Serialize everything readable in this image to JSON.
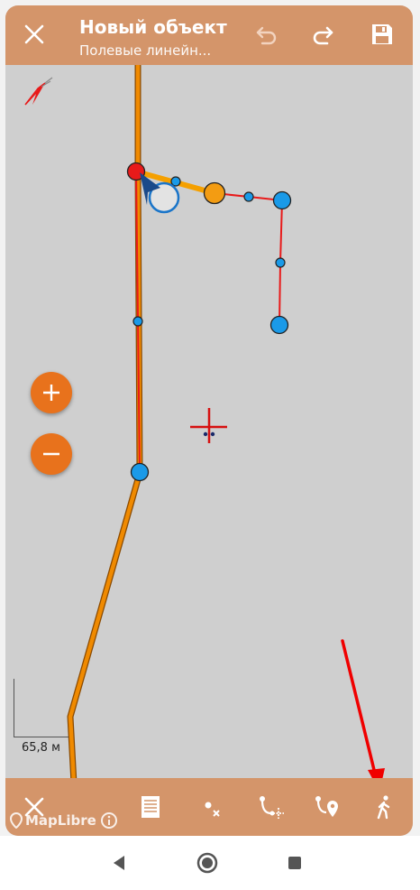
{
  "header": {
    "title": "Новый объект",
    "subtitle": "Полевые линейн..."
  },
  "map": {
    "scale_label": "65,8 м",
    "attribution": "MapLibre"
  },
  "colors": {
    "toolbar_bg": "#d4956a",
    "map_bg": "#cfcfcf",
    "zoom_button": "#e8721c",
    "line_existing": "#f08a00",
    "line_edit": "#e81a1a",
    "vertex": "#1a9ae8",
    "active_vertex": "#f39c12",
    "annotation_arrow": "#f00000"
  },
  "icons": {
    "close": "close-icon",
    "undo": "undo-icon",
    "redo": "redo-icon",
    "save": "save-icon",
    "compass": "compass-icon",
    "zoom_in": "plus-icon",
    "zoom_out": "minus-icon",
    "crosshair": "crosshair-icon",
    "cancel": "close-icon",
    "attributes": "list-icon",
    "delete_point": "delete-point-icon",
    "add_point": "add-point-icon",
    "add_point_gps": "add-point-gps-icon",
    "walk_mode": "walk-icon",
    "info": "info-icon",
    "nav_back": "back-icon",
    "nav_home": "home-icon",
    "nav_recents": "recents-icon"
  }
}
